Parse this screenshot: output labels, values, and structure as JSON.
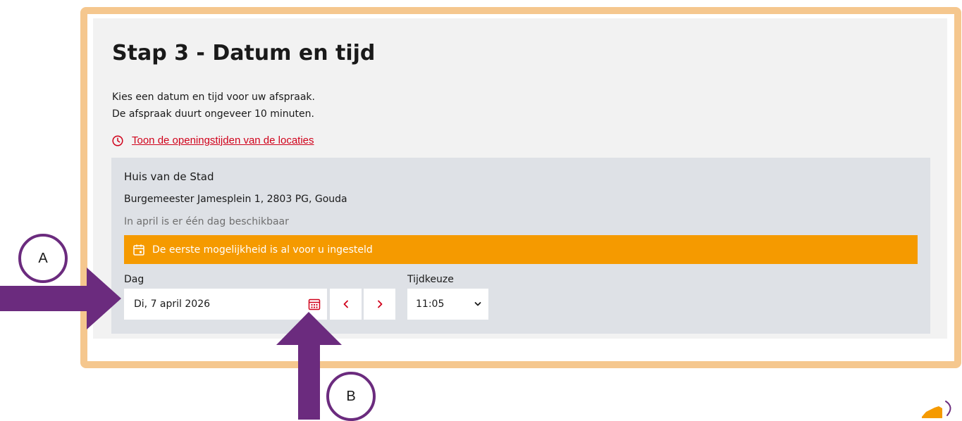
{
  "page": {
    "title": "Stap 3 - Datum en tijd",
    "intro_line1": "Kies een datum en tijd voor uw afspraak.",
    "intro_line2": "De afspraak duurt ongeveer 10 minuten.",
    "hours_link": "Toon de openingstijden van de locaties"
  },
  "location": {
    "name": "Huis van de Stad",
    "address": "Burgemeester Jamesplein 1, 2803 PG, Gouda",
    "availability": "In april is er één dag beschikbaar",
    "notice": "De eerste mogelijkheid is al voor u ingesteld"
  },
  "form": {
    "day_label": "Dag",
    "day_value": "Di, 7 april 2026",
    "time_label": "Tijdkeuze",
    "time_value": "11:05"
  },
  "annotations": {
    "a": "A",
    "b": "B"
  },
  "icons": {
    "clock": "clock-icon",
    "calendar_notice": "calendar-icon",
    "calendar_button": "calendar-picker-icon",
    "prev": "chevron-left-icon",
    "next": "chevron-right-icon",
    "select": "chevron-down-icon"
  },
  "colors": {
    "frame": "#f5c78e",
    "panel": "#f2f2f2",
    "location_bg": "#dee1e6",
    "notice_bg": "#f59a00",
    "link_red": "#d0021b",
    "arrow_purple": "#6b2b7e"
  }
}
